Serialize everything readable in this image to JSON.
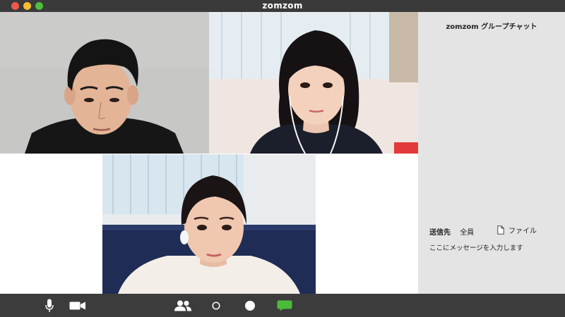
{
  "window": {
    "title": "zomzom"
  },
  "participants": [
    {
      "id": "participant-1",
      "background": "#c8c9c7",
      "shirt": "#161616"
    },
    {
      "id": "participant-2",
      "background": "#f0e7e2",
      "shirt": "#1a1e2a"
    },
    {
      "id": "participant-3",
      "background": "#1f2d55",
      "shirt": "#f3f0ea"
    }
  ],
  "chat": {
    "title": "zomzom グループチャット",
    "to_label": "送信先",
    "to_value": "全員",
    "file_label": "ファイル",
    "message_placeholder": "ここにメッセージを入力します"
  },
  "toolbar": {
    "icons": [
      "microphone-icon",
      "video-camera-icon",
      "participants-icon",
      "record-icon",
      "screen-share-icon",
      "chat-icon"
    ],
    "chat_color": "#4cbb3a"
  },
  "colors": {
    "titlebar": "#3a3a3a",
    "toolbar": "#3c3c3c",
    "chat_panel": "#e4e4e4",
    "close": "#ec5a4d",
    "minimize": "#f5bd2f",
    "maximize": "#4fbf3b"
  }
}
